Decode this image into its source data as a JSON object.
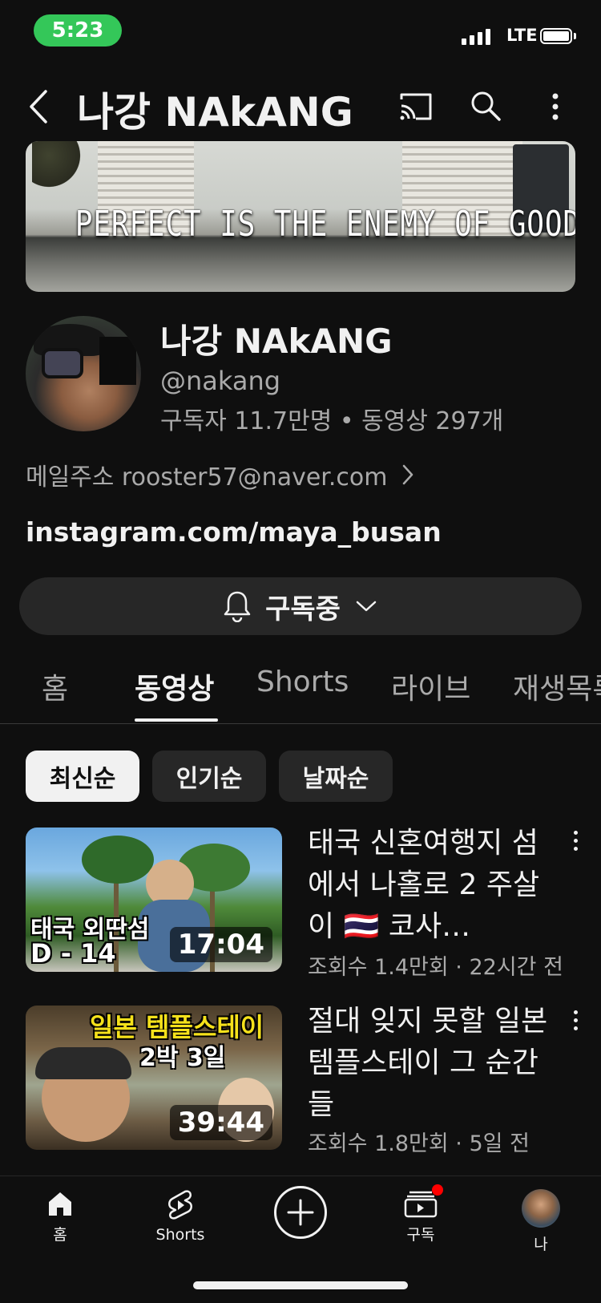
{
  "status_bar": {
    "time": "5:23",
    "network": "LTE"
  },
  "header": {
    "title": "나강 NAkANG"
  },
  "banner": {
    "text": "PERFECT IS THE ENEMY OF GOOD"
  },
  "channel": {
    "name": "나강 NAkANG",
    "handle": "@nakang",
    "stats": "구독자 11.7만명 • 동영상 297개",
    "email_label": "메일주소 rooster57@naver.com",
    "link": "instagram.com/maya_busan"
  },
  "subscribe": {
    "label": "구독중"
  },
  "tabs": [
    "홈",
    "동영상",
    "Shorts",
    "라이브",
    "재생목록"
  ],
  "active_tab": "동영상",
  "chips": [
    "최신순",
    "인기순",
    "날짜순"
  ],
  "videos": [
    {
      "title": "태국 신혼여행지 섬에서 나홀로 2 주살이 🇹🇭 코사…",
      "meta": "조회수 1.4만회 · 22시간 전",
      "duration": "17:04",
      "thumb_text_1": "태국 외딴섬",
      "thumb_text_2": "D - 14"
    },
    {
      "title": "절대 잊지 못할 일본 템플스테이 그 순간들",
      "meta": "조회수 1.8만회 · 5일 전",
      "duration": "39:44",
      "thumb_text_1": "일본 템플스테이",
      "thumb_text_2": "2박 3일"
    }
  ],
  "bottom_nav": {
    "home": "홈",
    "shorts": "Shorts",
    "subscriptions": "구독",
    "me": "나"
  },
  "colors": {
    "background": "#0f0f0f",
    "status_green": "#34c759",
    "notification_red": "#ff0000"
  }
}
